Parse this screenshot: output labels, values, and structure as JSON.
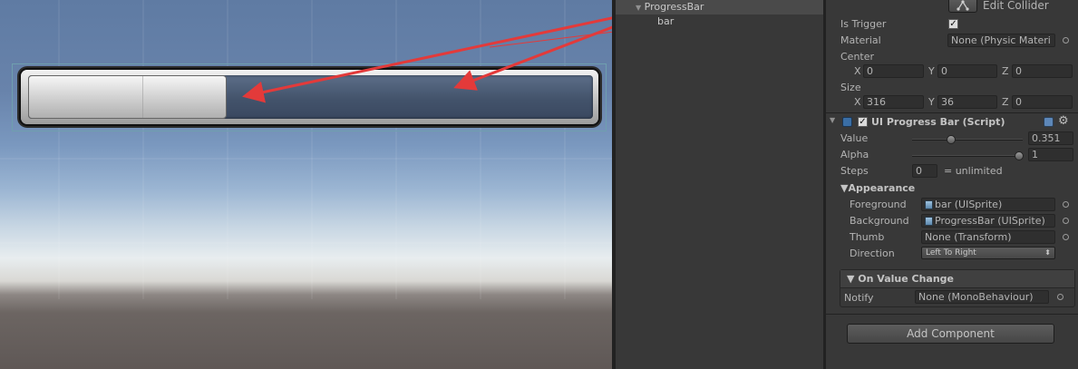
{
  "hierarchy": {
    "items": [
      {
        "label": "ProgressBar",
        "expanded": true
      },
      {
        "label": "bar"
      }
    ]
  },
  "scene": {
    "progress_value": 0.351,
    "fg_color": "#d8d8d8",
    "bg_color": "#4a5a72",
    "arrow_color": "#e33a3a"
  },
  "inspector": {
    "edit_collider_label": "Edit Collider",
    "is_trigger_label": "Is Trigger",
    "is_trigger_checked": "✓",
    "material_label": "Material",
    "material_value": "None (Physic Materi",
    "center_label": "Center",
    "center": {
      "x_label": "X",
      "x": "0",
      "y_label": "Y",
      "y": "0",
      "z_label": "Z",
      "z": "0"
    },
    "size_label": "Size",
    "size": {
      "x_label": "X",
      "x": "316",
      "y_label": "Y",
      "y": "36",
      "z_label": "Z",
      "z": "0"
    },
    "script": {
      "enabled_check": "✓",
      "title": "UI Progress Bar (Script)",
      "value_label": "Value",
      "value": "0.351",
      "alpha_label": "Alpha",
      "alpha": "1",
      "steps_label": "Steps",
      "steps": "0",
      "steps_suffix": "= unlimited",
      "appearance_label": "▼Appearance",
      "foreground_label": "Foreground",
      "foreground_value": "bar (UISprite)",
      "background_label": "Background",
      "background_value": "ProgressBar (UISprite)",
      "thumb_label": "Thumb",
      "thumb_value": "None (Transform)",
      "direction_label": "Direction",
      "direction_value": "Left To Right",
      "on_value_change_label": "▼ On Value Change",
      "notify_label": "Notify",
      "notify_value": "None (MonoBehaviour)"
    },
    "add_component_label": "Add Component"
  }
}
